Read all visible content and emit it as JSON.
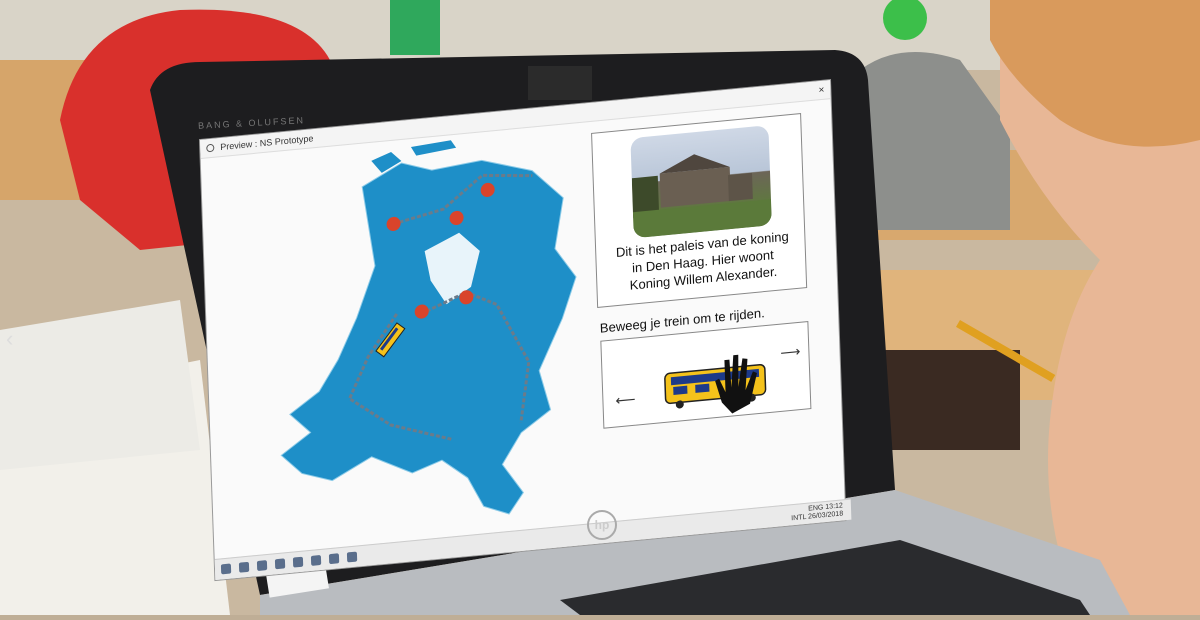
{
  "window": {
    "title": "Preview : NS Prototype",
    "close": "×"
  },
  "laptop": {
    "brand": "BANG & OLUFSEN",
    "logo": "hp"
  },
  "info": {
    "line1": "Dit is het paleis van de koning",
    "line2": "in Den Haag. Hier woont",
    "line3": "Koning Willem Alexander."
  },
  "instruction": "Beweeg je trein om te rijden.",
  "controls": {
    "left_arrow": "⟵",
    "right_arrow": "⟶"
  },
  "taskbar": {
    "lang1": "ENG",
    "lang2": "INTL",
    "time": "13:12",
    "date": "26/03/2018"
  },
  "map": {
    "land_color": "#1e8fc8",
    "station_color": "#d9442b"
  },
  "nav": {
    "prev": "‹"
  }
}
